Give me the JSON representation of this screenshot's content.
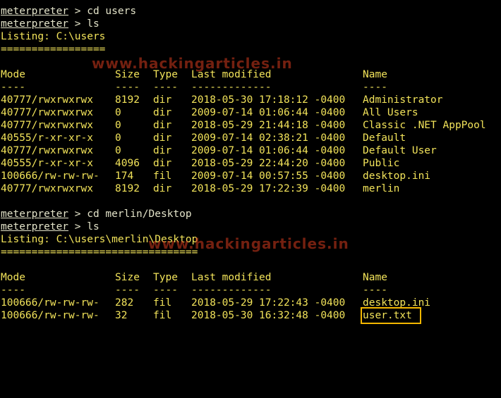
{
  "watermark": "www.hackingarticles.in",
  "session1": {
    "prompt": "meterpreter",
    "cmd1": " > cd users",
    "cmd2": " > ls",
    "listing": "Listing: C:\\users",
    "rule": "=================",
    "headers": [
      "Mode",
      "Size",
      "Type",
      "Last modified",
      "Name"
    ],
    "dashes": [
      "----",
      "----",
      "----",
      "-------------",
      "----"
    ],
    "rows": [
      [
        "40777/rwxrwxrwx",
        "8192",
        "dir",
        "2018-05-30 17:18:12 -0400",
        "Administrator"
      ],
      [
        "40777/rwxrwxrwx",
        "0",
        "dir",
        "2009-07-14 01:06:44 -0400",
        "All Users"
      ],
      [
        "40777/rwxrwxrwx",
        "0",
        "dir",
        "2018-05-29 21:44:18 -0400",
        "Classic .NET AppPool"
      ],
      [
        "40555/r-xr-xr-x",
        "0",
        "dir",
        "2009-07-14 02:38:21 -0400",
        "Default"
      ],
      [
        "40777/rwxrwxrwx",
        "0",
        "dir",
        "2009-07-14 01:06:44 -0400",
        "Default User"
      ],
      [
        "40555/r-xr-xr-x",
        "4096",
        "dir",
        "2018-05-29 22:44:20 -0400",
        "Public"
      ],
      [
        "100666/rw-rw-rw-",
        "174",
        "fil",
        "2009-07-14 00:57:55 -0400",
        "desktop.ini"
      ],
      [
        "40777/rwxrwxrwx",
        "8192",
        "dir",
        "2018-05-29 17:22:39 -0400",
        "merlin"
      ]
    ]
  },
  "session2": {
    "prompt": "meterpreter",
    "cmd1": " > cd merlin/Desktop",
    "cmd2": " > ls",
    "listing": "Listing: C:\\users\\merlin\\Desktop",
    "rule": "================================",
    "headers": [
      "Mode",
      "Size",
      "Type",
      "Last modified",
      "Name"
    ],
    "dashes": [
      "----",
      "----",
      "----",
      "-------------",
      "----"
    ],
    "rows": [
      [
        "100666/rw-rw-rw-",
        "282",
        "fil",
        "2018-05-29 17:22:43 -0400",
        "desktop.ini"
      ],
      [
        "100666/rw-rw-rw-",
        "32",
        "fil",
        "2018-05-30 16:32:48 -0400",
        "user.txt"
      ]
    ]
  }
}
